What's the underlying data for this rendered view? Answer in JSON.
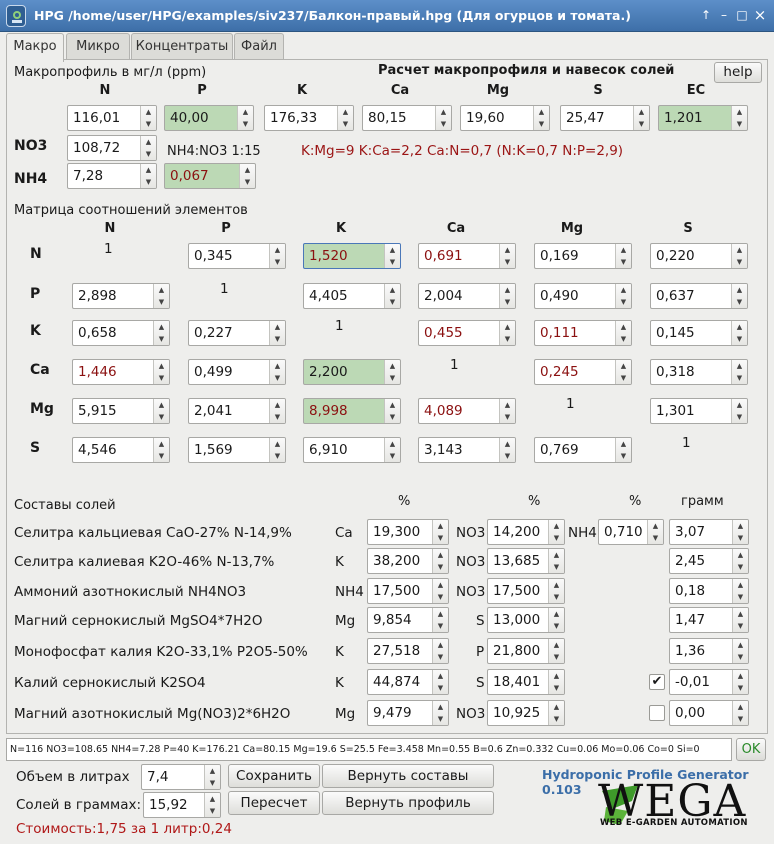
{
  "window": {
    "title": "HPG /home/user/HPG/examples/siv237/Балкон-правый.hpg (Для огурцов и томата.)",
    "btn_up": "↑",
    "btn_min": "–",
    "btn_max": "□",
    "btn_close": "×"
  },
  "tabs": [
    {
      "label": "Макро"
    },
    {
      "label": "Микро"
    },
    {
      "label": "Концентраты"
    },
    {
      "label": "Файл"
    }
  ],
  "macro": {
    "profile_label": "Макропрофиль в мг/л (ppm)",
    "calc_title": "Расчет макропрофиля и навесок солей",
    "help": "help",
    "headers": [
      "N",
      "P",
      "K",
      "Ca",
      "Mg",
      "S",
      "EC"
    ],
    "values": [
      "116,01",
      "40,00",
      "176,33",
      "80,15",
      "19,60",
      "25,47",
      "1,201"
    ],
    "no3_label": "NO3",
    "no3_value": "108,72",
    "nh4_label": "NH4",
    "nh4_value": "7,28",
    "ratio_label": "NH4:NO3 1:15",
    "ratio_value": "0,067",
    "ratios_text": "K:Mg=9 K:Ca=2,2 Ca:N=0,7 (N:K=0,7 N:P=2,9)"
  },
  "matrix": {
    "title": "Матрица соотношений элементов",
    "cols": [
      "N",
      "P",
      "K",
      "Ca",
      "Mg",
      "S"
    ],
    "rows": [
      {
        "label": "N",
        "cells": [
          "1",
          "0,345",
          "1,520",
          "0,691",
          "0,169",
          "0,220"
        ]
      },
      {
        "label": "P",
        "cells": [
          "2,898",
          "1",
          "4,405",
          "2,004",
          "0,490",
          "0,637"
        ]
      },
      {
        "label": "K",
        "cells": [
          "0,658",
          "0,227",
          "1",
          "0,455",
          "0,111",
          "0,145"
        ]
      },
      {
        "label": "Ca",
        "cells": [
          "1,446",
          "0,499",
          "2,200",
          "1",
          "0,245",
          "0,318"
        ]
      },
      {
        "label": "Mg",
        "cells": [
          "5,915",
          "2,041",
          "8,998",
          "4,089",
          "1",
          "1,301"
        ]
      },
      {
        "label": "S",
        "cells": [
          "4,546",
          "1,569",
          "6,910",
          "3,143",
          "0,769",
          "1"
        ]
      }
    ]
  },
  "salts": {
    "title": "Составы солей",
    "pct1": "%",
    "pct2": "%",
    "pct3": "%",
    "gram": "грамм",
    "rows": [
      {
        "name": "Селитра кальциевая CaO-27% N-14,9%",
        "e1": "Ca",
        "v1": "19,300",
        "e2": "NO3",
        "v2": "14,200",
        "e3": "NH4",
        "v3": "0,710",
        "grams": "3,07"
      },
      {
        "name": "Селитра калиевая K2O-46% N-13,7%",
        "e1": "K",
        "v1": "38,200",
        "e2": "NO3",
        "v2": "13,685",
        "grams": "2,45"
      },
      {
        "name": "Аммоний азотнокислый NH4NO3",
        "e1": "NH4",
        "v1": "17,500",
        "e2": "NO3",
        "v2": "17,500",
        "grams": "0,18"
      },
      {
        "name": "Магний сернокислый MgSO4*7H2O",
        "e1": "Mg",
        "v1": "9,854",
        "e2": "S",
        "v2": "13,000",
        "grams": "1,47"
      },
      {
        "name": "Монофосфат калия K2O-33,1% P2O5-50%",
        "e1": "K",
        "v1": "27,518",
        "e2": "P",
        "v2": "21,800",
        "grams": "1,36"
      },
      {
        "name": "Калий сернокислый K2SO4",
        "e1": "K",
        "v1": "44,874",
        "e2": "S",
        "v2": "18,401",
        "grams": "-0,01",
        "check": "✔"
      },
      {
        "name": "Магний азотнокислый Mg(NO3)2*6H2O",
        "e1": "Mg",
        "v1": "9,479",
        "e2": "NO3",
        "v2": "10,925",
        "grams": "0,00",
        "check": ""
      }
    ]
  },
  "status_line": "N=116 NO3=108.65 NH4=7.28 P=40 K=176.21 Ca=80.15 Mg=19.6 S=25.5 Fe=3.458 Mn=0.55 B=0.6 Zn=0.332 Cu=0.06 Mo=0.06 Co=0 Si=0",
  "ok": "OK",
  "bottom": {
    "volume_label": "Объем в литрах",
    "volume_value": "7,4",
    "salts_label": "Солей в граммах:",
    "salts_value": "15,92",
    "save": "Сохранить",
    "recalc": "Пересчет",
    "restore_salts": "Вернуть составы",
    "restore_profile": "Вернуть профиль",
    "cost": "Стоимость:1,75 за 1 литр:0,24"
  },
  "branding": {
    "generator": "Hydroponic Profile Generator 0.103",
    "logo": "WEGA",
    "logo_sub": "WEB E-GARDEN AUTOMATION"
  },
  "colors": {
    "title_bar": "#4a7bb8",
    "green_field": "#bcd9b5",
    "dark_red": "#8b1010",
    "cost_red": "#b01818"
  }
}
